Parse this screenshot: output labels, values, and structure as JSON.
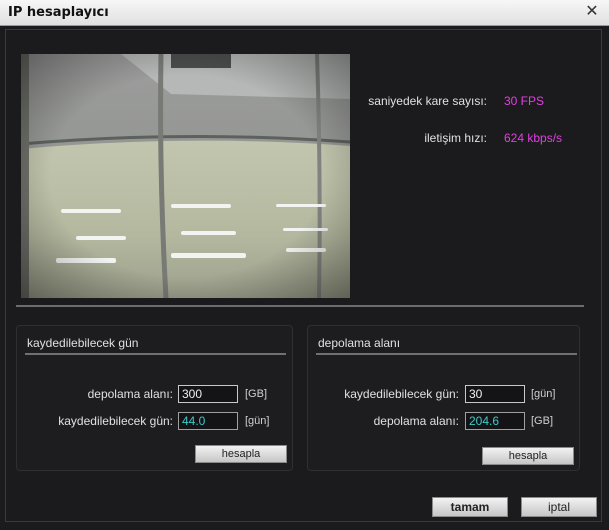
{
  "window": {
    "title": "IP hesaplayıcı",
    "close_glyph": "✕"
  },
  "stats": {
    "fps_label": "saniyedek kare sayısı:",
    "fps_value": "30 FPS",
    "bitrate_label": "iletişim hızı:",
    "bitrate_value": "624 kbps/s",
    "value_color": "#e23fe2"
  },
  "left_panel": {
    "title": "kaydedilebilecek gün",
    "storage_label": "depolama alanı:",
    "storage_value": "300",
    "storage_unit": "[GB]",
    "days_label": "kaydedilebilecek gün:",
    "days_value": "44.0",
    "days_unit": "[gün]",
    "calc_button": "hesapla"
  },
  "right_panel": {
    "title": "depolama alanı",
    "days_label": "kaydedilebilecek gün:",
    "days_value": "30",
    "days_unit": "[gün]",
    "storage_label": "depolama alanı:",
    "storage_value": "204.6",
    "storage_unit": "[GB]",
    "calc_button": "hesapla"
  },
  "footer": {
    "ok_button": "tamam",
    "cancel_button": "iptal"
  }
}
